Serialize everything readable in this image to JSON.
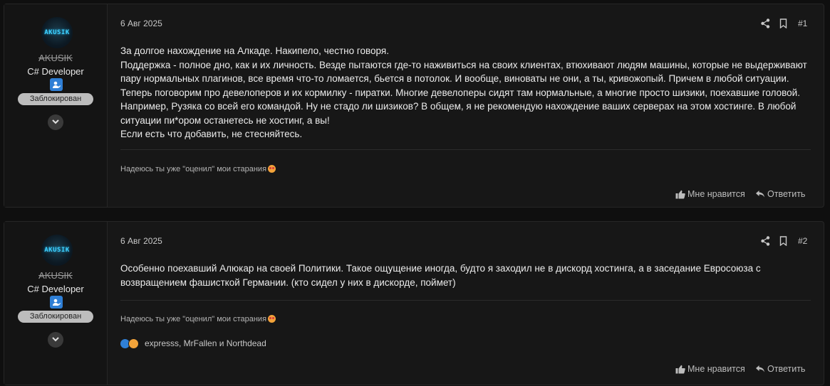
{
  "posts": [
    {
      "user": {
        "avatar_text": "AKUSIK",
        "name": "AKUSIK",
        "title": "C# Developer",
        "badge": "Заблокирован"
      },
      "date": "6 Авг 2025",
      "number": "#1",
      "body": [
        "За долгое нахождение на Алкаде. Накипело, честно говоря.",
        "Поддержка - полное дно, как и их личность. Везде пытаются где-то наживиться на своих клиентах, втюхивают людям машины, которые не выдерживают пару нормальных плагинов, все время что-то ломается, бьется в потолок. И вообще, виноваты не они, а ты, кривожопый. Причем в любой ситуации.",
        "Теперь поговорим про девелоперов и их кормилку - пиратки. Многие девелоперы сидят там нормальные, а многие просто шизики, поехавшие головой. Например, Рузяка со всей его командой. Ну не стадо ли шизиков? В общем, я не рекомендую нахождение ваших серверах на этом хостинге. В любой ситуации пи*ором останетесь не хостинг, а вы!",
        "Если есть что добавить, не стесняйтесь."
      ],
      "signature": "Надеюсь ты уже \"оценил\" мои старания",
      "like_label": "Мне нравится",
      "reply_label": "Ответить"
    },
    {
      "user": {
        "avatar_text": "AKUSIK",
        "name": "AKUSIK",
        "title": "C# Developer",
        "badge": "Заблокирован"
      },
      "date": "6 Авг 2025",
      "number": "#2",
      "body": [
        "Особенно поехавший Алюкар на своей Политики. Такое ощущение иногда, будто я заходил не в дискорд хостинга, а в заседание Евросоюза с возвращением фашисткой Германии. (кто сидел у них в дискорде, поймет)"
      ],
      "signature": "Надеюсь ты уже \"оценил\" мои старания",
      "reactions_text": "expresss, MrFallen и Northdead",
      "like_label": "Мне нравится",
      "reply_label": "Ответить"
    }
  ],
  "icons": {
    "share": "share-icon",
    "bookmark": "bookmark-icon",
    "like": "thumbs-up-icon",
    "reply": "reply-icon",
    "expand": "chevron-down-icon"
  },
  "colors": {
    "page_bg": "#0f0f0f",
    "post_bg": "#171717",
    "badge_bg": "#bdbdbd",
    "accent": "#2f7fd6"
  }
}
